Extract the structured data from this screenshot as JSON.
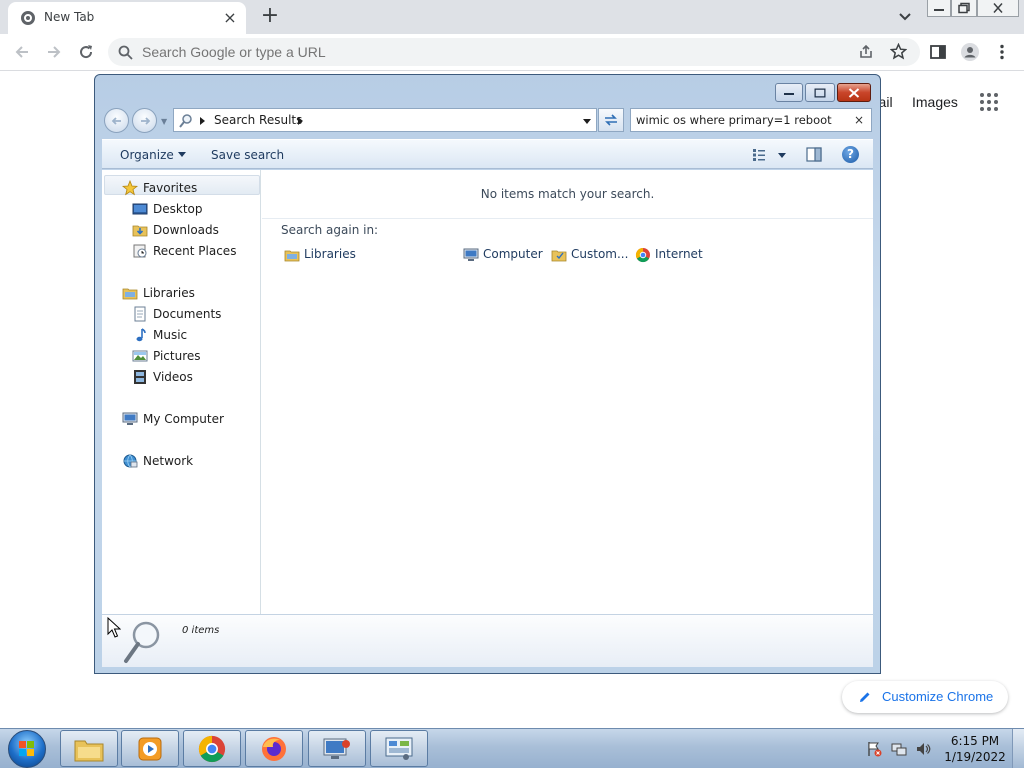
{
  "chrome": {
    "tab_title": "New Tab",
    "tab_close": "×",
    "new_tab": "+",
    "omnibox_placeholder": "Search Google or type a URL",
    "ntp_links": {
      "gmail": "Gmail",
      "images": "Images"
    },
    "customize_label": "Customize Chrome"
  },
  "explorer": {
    "breadcrumb": "Search Results",
    "search_query": "wimic os where primary=1 reboot",
    "clear_search": "×",
    "toolbar": {
      "organize": "Organize",
      "save_search": "Save search",
      "help": "?"
    },
    "nav": {
      "favorites": "Favorites",
      "favorites_items": [
        "Desktop",
        "Downloads",
        "Recent Places"
      ],
      "libraries": "Libraries",
      "libraries_items": [
        "Documents",
        "Music",
        "Pictures",
        "Videos"
      ],
      "computer": "My Computer",
      "network": "Network"
    },
    "results": {
      "empty_message": "No items match your search.",
      "search_again_label": "Search again in:",
      "locations": [
        "Libraries",
        "Computer",
        "Custom...",
        "Internet"
      ]
    },
    "details": {
      "item_count": "0 items"
    }
  },
  "taskbar": {
    "items": [
      "explorer",
      "media-player",
      "chrome",
      "firefox",
      "remote-desktop",
      "control-panel"
    ],
    "clock_time": "6:15 PM",
    "clock_date": "1/19/2022"
  },
  "colors": {
    "chrome_accent": "#1a73e8",
    "chrome_tabstrip": "#dee1e6",
    "explorer_frame": "#b7cde5",
    "taskbar": "#a9bfd8"
  }
}
